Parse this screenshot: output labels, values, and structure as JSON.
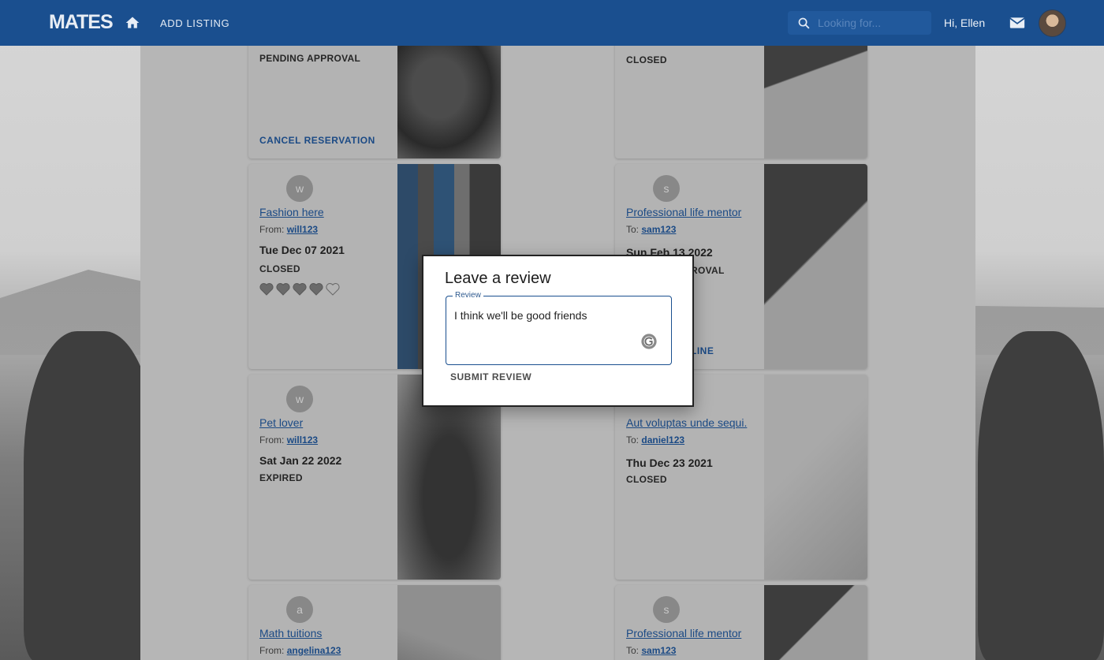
{
  "header": {
    "logo": "MATES",
    "add_listing": "ADD LISTING",
    "search_placeholder": "Looking for...",
    "greeting": "Hi, Ellen"
  },
  "cards": {
    "top_left": {
      "status": "PENDING APPROVAL",
      "action": "CANCEL RESERVATION"
    },
    "top_right": {
      "status": "CLOSED"
    },
    "fashion": {
      "initial": "w",
      "title": "Fashion here",
      "from_label": "From:",
      "user": "will123",
      "date": "Tue Dec 07 2021",
      "status": "CLOSED",
      "rating": 4,
      "max_rating": 5
    },
    "mentor1": {
      "initial": "s",
      "title": "Professional life mentor",
      "to_label": "To:",
      "user": "sam123",
      "date": "Sun Feb 13 2022",
      "status_partial": "ROVAL",
      "action_partial": "LINE"
    },
    "pet": {
      "initial": "w",
      "title": "Pet lover",
      "from_label": "From:",
      "user": "will123",
      "date": "Sat Jan 22 2022",
      "status": "EXPIRED"
    },
    "aut": {
      "title": "Aut voluptas unde sequi.",
      "to_label": "To:",
      "user": "daniel123",
      "date": "Thu Dec 23 2021",
      "status": "CLOSED"
    },
    "math": {
      "initial": "a",
      "title": "Math tuitions",
      "from_label": "From:",
      "user": "angelina123"
    },
    "mentor2": {
      "initial": "s",
      "title": "Professional life mentor",
      "to_label": "To:",
      "user": "sam123"
    }
  },
  "dialog": {
    "title": "Leave a review",
    "field_label": "Review",
    "field_value": "I think we'll be good friends",
    "submit_label": "SUBMIT REVIEW"
  },
  "colors": {
    "header_bg": "#1a4f8f",
    "link": "#1b4a85"
  }
}
